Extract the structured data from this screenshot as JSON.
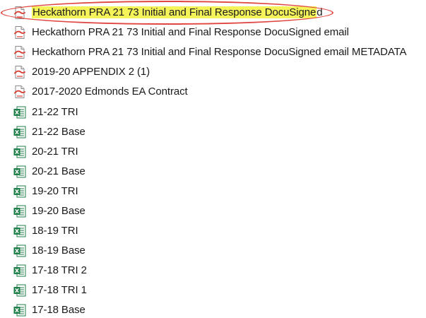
{
  "file_list": {
    "items": [
      {
        "name": "Heckathorn PRA 21 73 Initial and Final Response DocuSigned",
        "icon": "pdf-file-icon",
        "highlight_part": "Heckathorn PRA 21 73 Initial and Final Response DocuSigne",
        "rest_part": "d",
        "highlighted": true
      },
      {
        "name": "Heckathorn PRA 21 73 Initial and Final Response DocuSigned email",
        "icon": "pdf-file-icon"
      },
      {
        "name": "Heckathorn PRA 21 73 Initial and Final Response DocuSigned email METADATA",
        "icon": "pdf-file-icon"
      },
      {
        "name": "2019-20 APPENDIX 2 (1)",
        "icon": "pdf-file-icon"
      },
      {
        "name": "2017-2020 Edmonds EA Contract",
        "icon": "pdf-file-icon"
      },
      {
        "name": "21-22 TRI",
        "icon": "spreadsheet-file-icon"
      },
      {
        "name": "21-22 Base",
        "icon": "spreadsheet-file-icon"
      },
      {
        "name": "20-21 TRI",
        "icon": "spreadsheet-file-icon"
      },
      {
        "name": "20-21 Base",
        "icon": "spreadsheet-file-icon"
      },
      {
        "name": "19-20 TRI",
        "icon": "spreadsheet-file-icon"
      },
      {
        "name": "19-20 Base",
        "icon": "spreadsheet-file-icon"
      },
      {
        "name": "18-19 TRI",
        "icon": "spreadsheet-file-icon"
      },
      {
        "name": "18-19 Base",
        "icon": "spreadsheet-file-icon"
      },
      {
        "name": "17-18 TRI 2",
        "icon": "spreadsheet-file-icon"
      },
      {
        "name": "17-18 TRI 1",
        "icon": "spreadsheet-file-icon"
      },
      {
        "name": "17-18 Base",
        "icon": "spreadsheet-file-icon"
      }
    ]
  },
  "colors": {
    "highlight": "#f4f35a",
    "annotation": "#e0463f",
    "pdf_accent": "#d8392b",
    "spreadsheet_accent": "#1e7f48"
  }
}
